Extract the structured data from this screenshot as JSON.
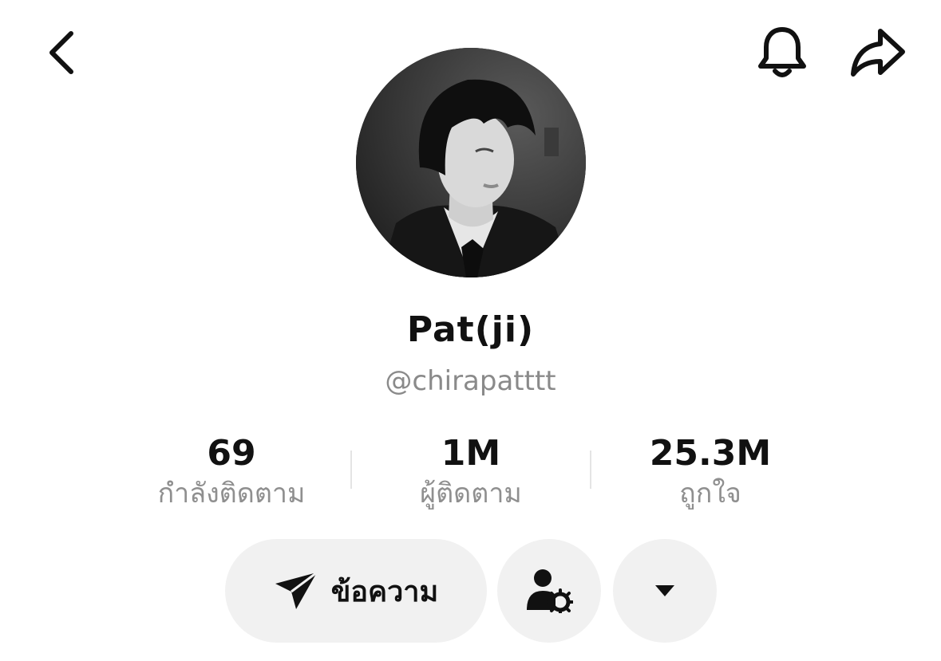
{
  "header": {
    "back_icon": "chevron-left-icon",
    "bell_icon": "bell-icon",
    "share_icon": "share-arrow-icon"
  },
  "profile": {
    "avatar": "profile-photo",
    "display_name": "Pat(ji)",
    "username": "@chirapatttt"
  },
  "stats": [
    {
      "value": "69",
      "label": "กำลังติดตาม"
    },
    {
      "value": "1M",
      "label": "ผู้ติดตาม"
    },
    {
      "value": "25.3M",
      "label": "ถูกใจ"
    }
  ],
  "actions": {
    "message_label": "ข้อความ",
    "message_icon": "send-icon",
    "friend_settings_icon": "user-gear-icon",
    "more_icon": "caret-down-icon"
  },
  "colors": {
    "text": "#111111",
    "muted": "#8a8a8a",
    "button_bg": "#f1f1f1"
  }
}
